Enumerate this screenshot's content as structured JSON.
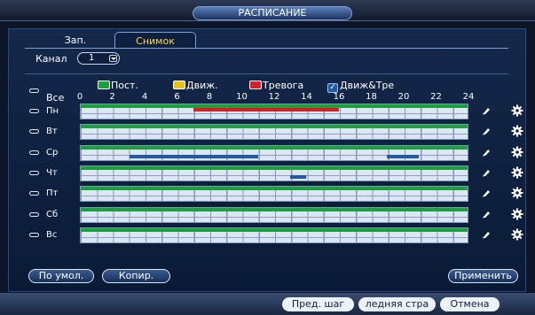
{
  "window": {
    "title": "РАСПИСАНИЕ"
  },
  "tabs": [
    {
      "label": "Зап.",
      "active": false
    },
    {
      "label": "Снимок",
      "active": true
    }
  ],
  "channel": {
    "label": "Канал",
    "value": "1"
  },
  "legend": {
    "constant": {
      "label": "Пост.",
      "color": "#1aa23a"
    },
    "motion": {
      "label": "Движ.",
      "color": "#e5c21c"
    },
    "alarm": {
      "label": "Тревога",
      "color": "#d3202a"
    },
    "motion_alarm": {
      "label": "Движ&Тре",
      "color": "#1e5aa8",
      "checked": true
    }
  },
  "all_label": "Все",
  "hours": [
    "0",
    "2",
    "4",
    "6",
    "8",
    "10",
    "12",
    "14",
    "16",
    "18",
    "20",
    "22",
    "24"
  ],
  "days": [
    {
      "label": "Пн",
      "segments": [
        {
          "type": "alarm",
          "start": 7,
          "end": 16
        }
      ]
    },
    {
      "label": "Вт",
      "segments": []
    },
    {
      "label": "Ср",
      "segments": [
        {
          "type": "motion_alarm",
          "start": 3,
          "end": 11
        },
        {
          "type": "motion_alarm",
          "start": 19,
          "end": 21
        }
      ]
    },
    {
      "label": "Чт",
      "segments": [
        {
          "type": "motion_alarm",
          "start": 13,
          "end": 14
        }
      ]
    },
    {
      "label": "Пт",
      "segments": []
    },
    {
      "label": "Сб",
      "segments": []
    },
    {
      "label": "Вс",
      "segments": []
    }
  ],
  "buttons": {
    "default": "По умол.",
    "copy": "Копир.",
    "apply": "Применить"
  },
  "footer": {
    "prev": "Пред. шаг",
    "last": "ледняя стра",
    "cancel": "Отмена"
  }
}
